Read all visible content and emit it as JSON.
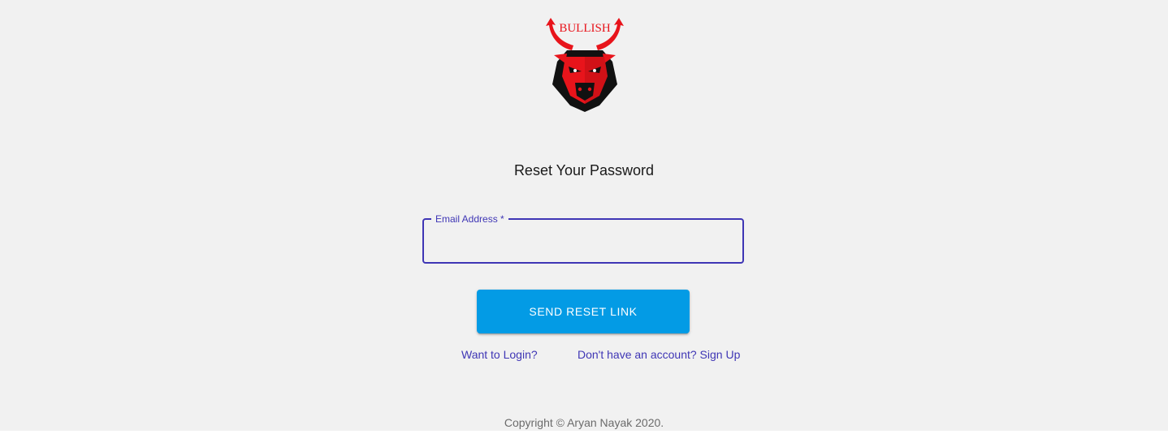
{
  "logo": {
    "text": "BULLISH",
    "icon": "bull-logo-icon",
    "accent_color": "#e8141b"
  },
  "page": {
    "title": "Reset Your Password"
  },
  "form": {
    "email_label": "Email Address",
    "required_marker": " *",
    "email_value": "",
    "focus_color": "#3f36b5"
  },
  "actions": {
    "send_label": "SEND RESET LINK",
    "send_color": "#039be5",
    "login_link": "Want to Login?",
    "signup_link": "Don't have an account? Sign Up"
  },
  "footer": {
    "copyright": "Copyright © Aryan Nayak 2020."
  }
}
